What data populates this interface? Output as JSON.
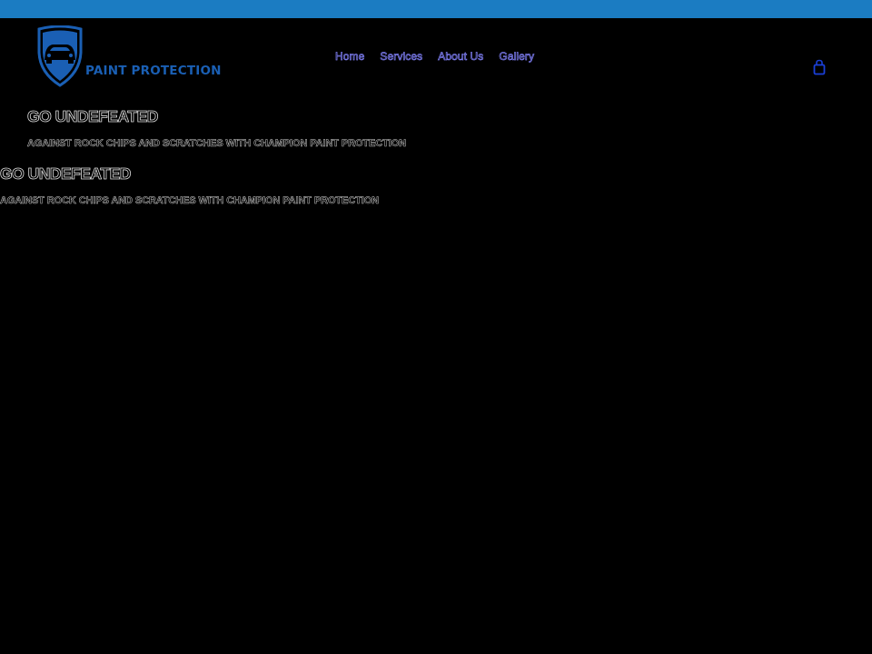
{
  "brand": {
    "name": "PAINT PROTECTION",
    "accent_color": "#1a5fb4",
    "top_bar_color": "#1b7cc2"
  },
  "nav": {
    "items": [
      {
        "label": "Home"
      },
      {
        "label": "Services"
      },
      {
        "label": "About Us"
      },
      {
        "label": "Gallery"
      }
    ],
    "link_color": "#7d7df2"
  },
  "cart": {
    "icon": "shopping-bag-icon"
  },
  "hero": [
    {
      "title": "GO UNDEFEATED",
      "subtitle": "AGAINST ROCK CHIPS AND SCRATCHES WITH CHAMPION PAINT PROTECTION"
    },
    {
      "title": "GO UNDEFEATED",
      "subtitle": "AGAINST ROCK CHIPS AND SCRATCHES WITH CHAMPION PAINT PROTECTION"
    }
  ]
}
